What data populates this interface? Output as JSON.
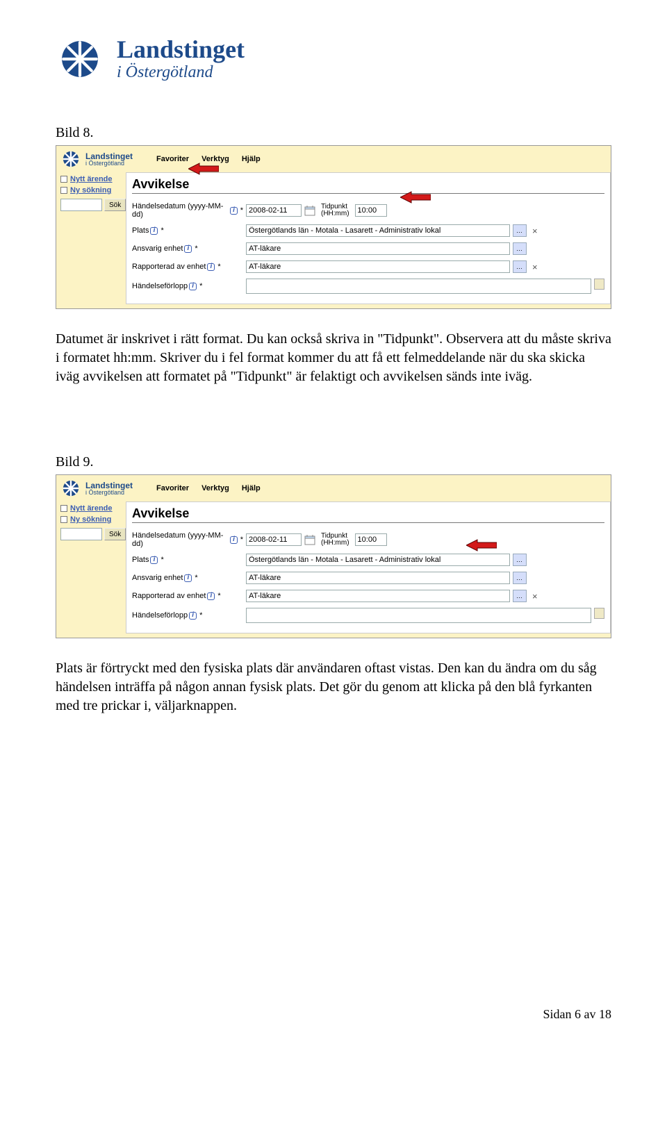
{
  "header": {
    "title": "Landstinget",
    "subtitle": "i Östergötland"
  },
  "captions": {
    "bild8": "Bild 8.",
    "bild9": "Bild 9."
  },
  "para1": "Datumet är inskrivet i rätt format. Du kan också skriva in \"Tidpunkt\". Observera att du måste skriva i formatet hh:mm. Skriver du i fel format kommer du att få ett felmeddelande när du ska skicka iväg avvikelsen att formatet på \"Tidpunkt\" är felaktigt och avvikelsen sänds inte iväg.",
  "para2": "Plats är förtryckt med den fysiska plats där användaren oftast vistas. Den kan du ändra om du såg händelsen inträffa på någon annan fysisk plats. Det gör du genom att klicka på den blå fyrkanten med tre prickar i, väljarknappen.",
  "app": {
    "menu": {
      "fav": "Favoriter",
      "verktyg": "Verktyg",
      "hjalp": "Hjälp"
    },
    "side": {
      "nytt": "Nytt ärende",
      "nysok": "Ny sökning",
      "sok": "Sök"
    },
    "heading": "Avvikelse",
    "labels": {
      "datum": "Händelsedatum (yyyy-MM-dd)",
      "tidpunkt": "Tidpunkt",
      "tidfmt": "(HH:mm)",
      "plats": "Plats",
      "ansvarig": "Ansvarig enhet",
      "rapporterad": "Rapporterad av enhet",
      "forlopp": "Händelseförlopp"
    },
    "values": {
      "date": "2008-02-11",
      "time": "10:00",
      "plats": "Östergötlands län - Motala - Lasarett - Administrativ lokal",
      "ansvarig": "AT-läkare",
      "rapporterad": "AT-läkare"
    }
  },
  "footer": {
    "page_label": "Sidan 6 av 18"
  }
}
